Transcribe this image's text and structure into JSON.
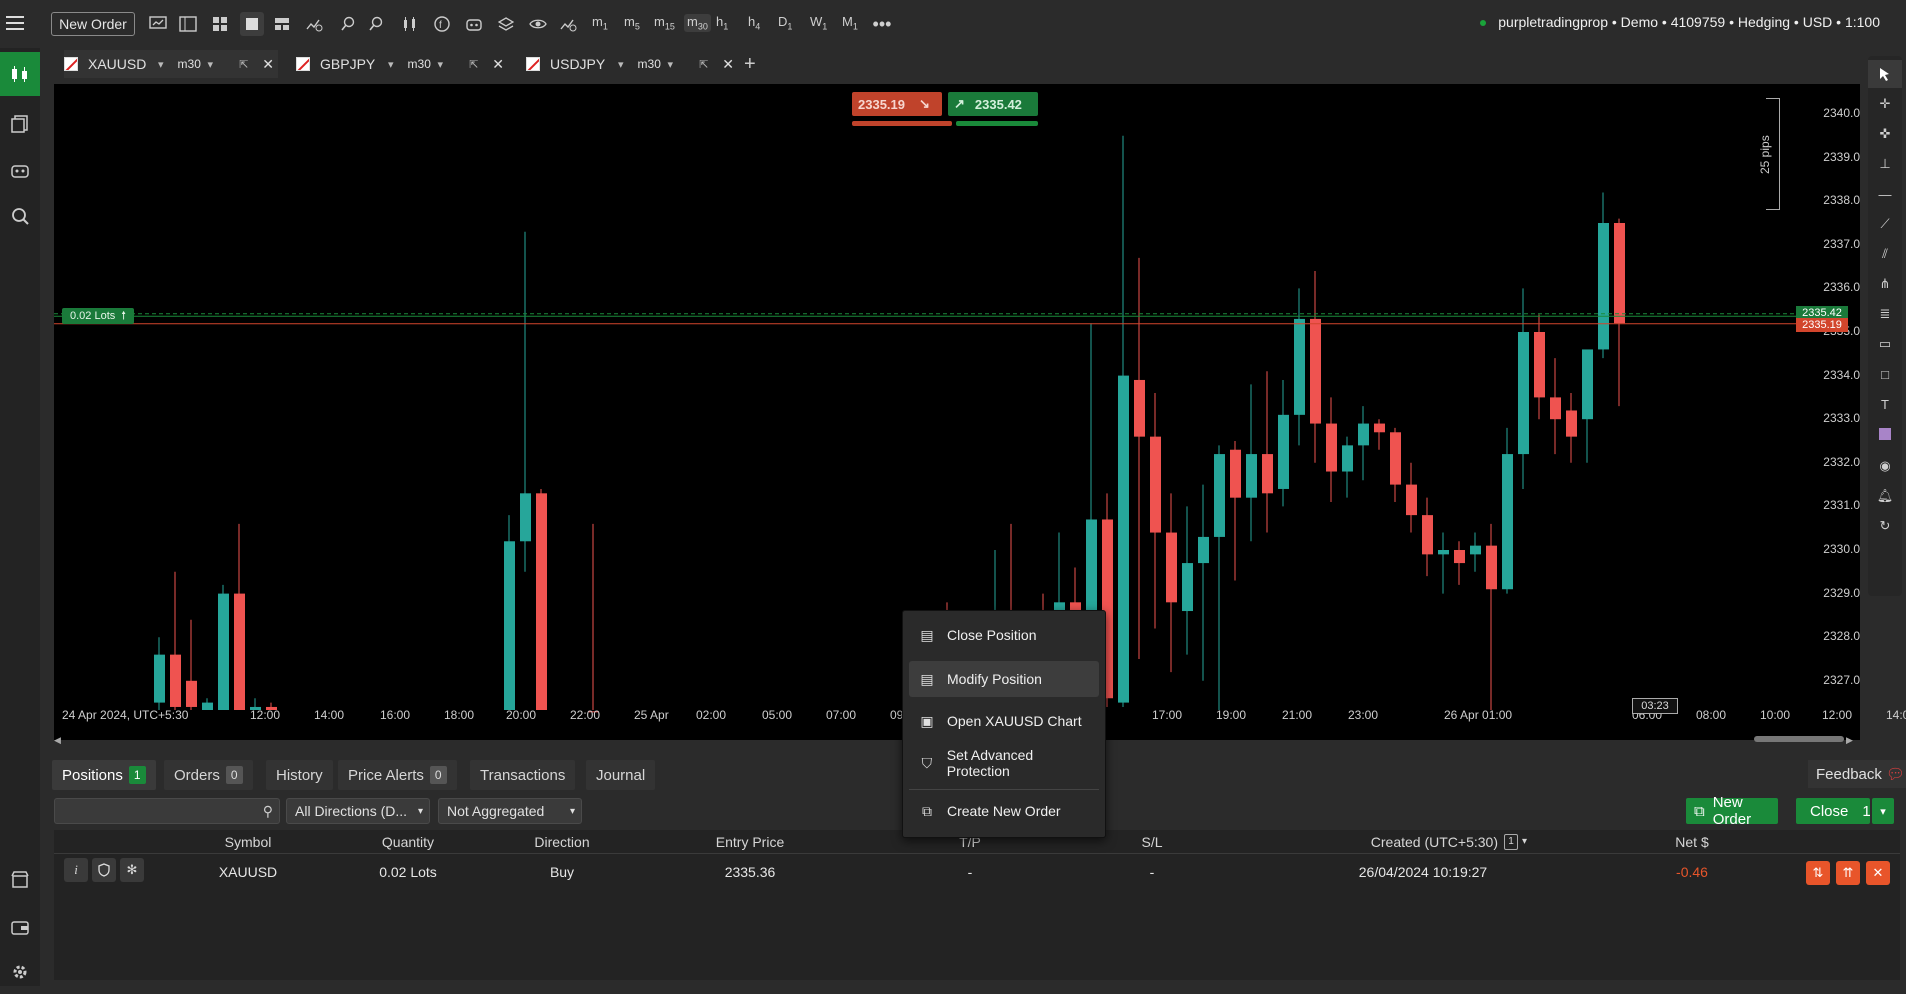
{
  "topbar": {
    "new_order_label": "New Order",
    "timeframes": [
      "m1",
      "m5",
      "m15",
      "m30",
      "h1",
      "h4",
      "D1",
      "W1",
      "M1"
    ],
    "account_info": "purpletradingprop • Demo • 4109759 • Hedging • USD • 1:100"
  },
  "tabs": [
    {
      "symbol": "XAUUSD",
      "tf": "m30"
    },
    {
      "symbol": "GBPJPY",
      "tf": "m30"
    },
    {
      "symbol": "USDJPY",
      "tf": "m30"
    }
  ],
  "chart": {
    "sell_price": "2335.19",
    "buy_price": "2335.42",
    "position_label": "0.02 Lots",
    "pips_label": "25 pips",
    "bid_tag": "2335.19",
    "ask_tag": "2335.42",
    "countdown": "03:23",
    "price_ticks": [
      "2340.0",
      "2339.0",
      "2338.0",
      "2337.0",
      "2336.0",
      "2335.0",
      "2334.0",
      "2333.0",
      "2332.0",
      "2331.0",
      "2330.0",
      "2329.0",
      "2328.0",
      "2327.0"
    ],
    "time_ticks": [
      "24 Apr 2024, UTC+5:30",
      "12:00",
      "14:00",
      "16:00",
      "18:00",
      "20:00",
      "22:00",
      "25 Apr",
      "02:00",
      "05:00",
      "07:00",
      "09",
      "",
      "17:00",
      "19:00",
      "21:00",
      "23:00",
      "26 Apr 01:00",
      "06:00",
      "08:00",
      "10:00",
      "12:00",
      "14:00"
    ]
  },
  "context_menu": {
    "items": [
      "Close Position",
      "Modify Position",
      "Open XAUUSD Chart",
      "Set Advanced Protection",
      "Create New Order"
    ]
  },
  "bottom": {
    "tabs": [
      {
        "label": "Positions",
        "badge": "1"
      },
      {
        "label": "Orders",
        "badge": "0"
      },
      {
        "label": "History",
        "badge": ""
      },
      {
        "label": "Price Alerts",
        "badge": "0"
      },
      {
        "label": "Transactions",
        "badge": ""
      },
      {
        "label": "Journal",
        "badge": ""
      }
    ],
    "direction_filter": "All Directions (D...",
    "aggregation_filter": "Not Aggregated",
    "new_order_btn": "New Order",
    "close_btn": "Close",
    "close_count": "1",
    "feedback": "Feedback",
    "columns": [
      "Symbol",
      "Quantity",
      "Direction",
      "Entry Price",
      "T/P",
      "S/L",
      "Created (UTC+5:30)",
      "Net $"
    ],
    "sort_indicator": "1",
    "row": {
      "symbol": "XAUUSD",
      "quantity": "0.02 Lots",
      "direction": "Buy",
      "entry_price": "2335.36",
      "tp": "-",
      "sl": "-",
      "created": "26/04/2024 10:19:27",
      "net": "-0.46"
    }
  }
}
